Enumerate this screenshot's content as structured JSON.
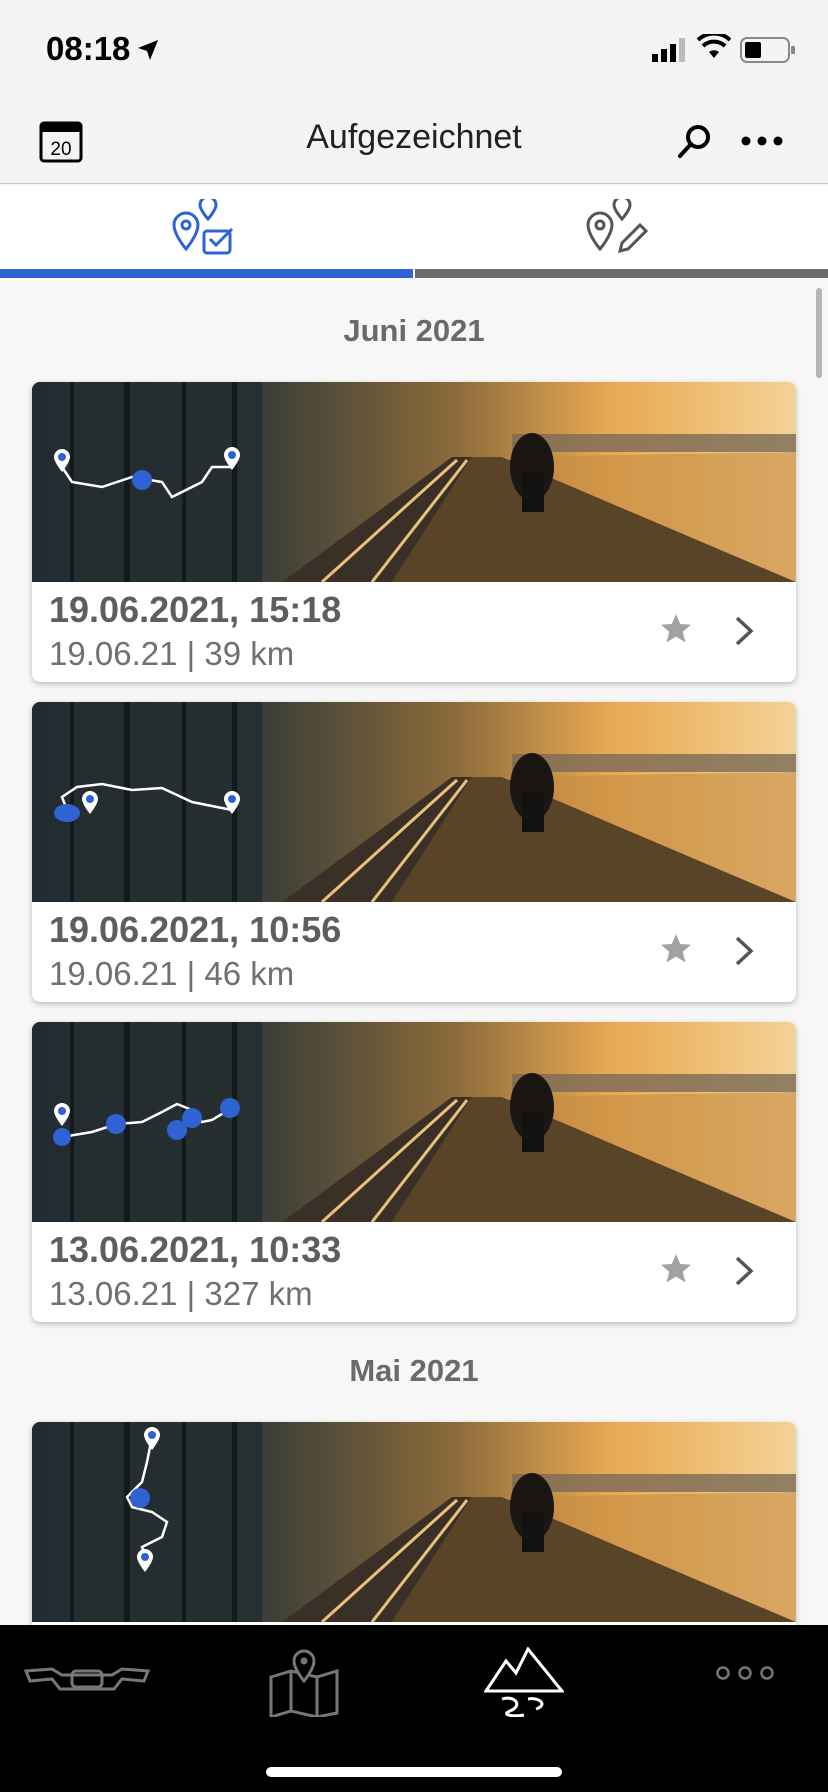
{
  "status_bar": {
    "time": "08:18"
  },
  "nav": {
    "title": "Aufgezeichnet",
    "calendar_day": "20"
  },
  "tabs": {
    "recorded_icon": "map-pin-check-icon",
    "planned_icon": "map-pin-edit-icon",
    "active": "recorded"
  },
  "colors": {
    "accent": "#2f63d4",
    "tab_inactive": "#6d6d6d",
    "bottom_bar": "#000000"
  },
  "sections": [
    {
      "header": "Juni 2021",
      "rides": [
        {
          "date_time": "19.06.2021, 15:18",
          "meta": "19.06.21 | 39 km"
        },
        {
          "date_time": "19.06.2021, 10:56",
          "meta": "19.06.21 | 46 km"
        },
        {
          "date_time": "13.06.2021, 10:33",
          "meta": "13.06.21 | 327 km"
        }
      ]
    },
    {
      "header": "Mai 2021",
      "rides": [
        {
          "date_time": "",
          "meta": ""
        }
      ]
    }
  ],
  "bottom_nav": [
    {
      "icon": "motorcycle-icon",
      "active": false
    },
    {
      "icon": "map-icon",
      "active": false
    },
    {
      "icon": "mountains-route-icon",
      "active": true
    },
    {
      "icon": "more-dots-icon",
      "active": false
    }
  ]
}
